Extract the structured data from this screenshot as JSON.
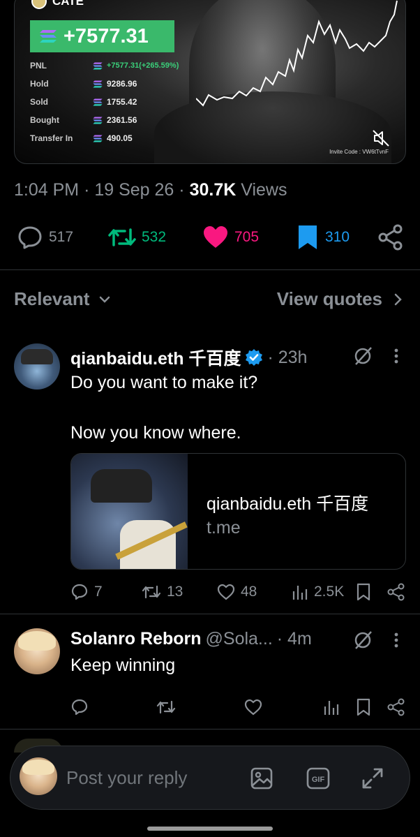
{
  "media": {
    "brand": "CATE",
    "pnl_headline": "+7577.31",
    "stats": [
      {
        "label": "PNL",
        "value": "+7577.31(+265.59%)"
      },
      {
        "label": "Hold",
        "value": "9286.96"
      },
      {
        "label": "Sold",
        "value": "1755.42"
      },
      {
        "label": "Bought",
        "value": "2361.56"
      },
      {
        "label": "Transfer In",
        "value": "490.05"
      }
    ],
    "invite_code": "Invite Code : VW6tTvnF"
  },
  "meta": {
    "time": "1:04 PM",
    "date": "19 Sep 26",
    "views_count": "30.7K",
    "views_label": "Views"
  },
  "main_actions": {
    "replies": "517",
    "reposts": "532",
    "likes": "705",
    "bookmarks": "310"
  },
  "filter": {
    "sort_label": "Relevant",
    "quotes_label": "View quotes"
  },
  "replies": [
    {
      "name": "qianbaidu.eth 千百度",
      "time": "· 23h",
      "text_line1": "Do you want to make it?",
      "text_line2": "Now you know where.",
      "card_title": "qianbaidu.eth 千百度",
      "card_domain": "t.me",
      "replies": "7",
      "reposts": "13",
      "likes": "48",
      "views": "2.5K"
    },
    {
      "name": "Solanro Reborn",
      "handle": "@Sola...",
      "time": "· 4m",
      "text": "Keep winning"
    }
  ],
  "composer": {
    "placeholder": "Post your reply"
  },
  "colors": {
    "like": "#f91880",
    "repost": "#00ba7c",
    "bookmark": "#1d9bf0",
    "verified": "#1d9bf0",
    "pnl_green": "#3ab96b"
  }
}
